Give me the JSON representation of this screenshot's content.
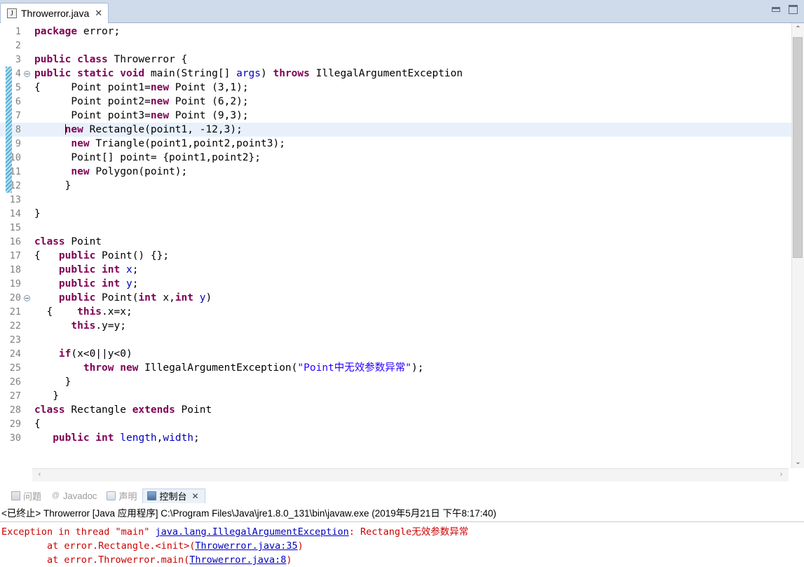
{
  "window": {
    "minimize_label": "Minimize",
    "maximize_label": "Maximize"
  },
  "editor": {
    "tab": {
      "title": "Throwerror.java",
      "icon": "java-file-icon",
      "icon_letter": "J",
      "close": "✕"
    },
    "scrollbar": {
      "up_arrow": "⌃",
      "down_arrow": "⌄",
      "left_arrow": "‹",
      "right_arrow": "›"
    },
    "lines": [
      {
        "n": "1",
        "fold": false,
        "annot": false,
        "hl": false,
        "html": "<span class='kw'>package</span> error;"
      },
      {
        "n": "2",
        "fold": false,
        "annot": false,
        "hl": false,
        "html": ""
      },
      {
        "n": "3",
        "fold": false,
        "annot": false,
        "hl": false,
        "html": "<span class='kw'>public class</span> Throwerror {"
      },
      {
        "n": "4",
        "fold": true,
        "annot": true,
        "hl": false,
        "html": "<span class='kw'>public static void</span> main(String[] <span class='fld'>args</span>) <span class='kw'>throws</span> IllegalArgumentException"
      },
      {
        "n": "5",
        "fold": false,
        "annot": true,
        "hl": false,
        "html": "{     Point point1=<span class='kw'>new</span> Point (3,1);"
      },
      {
        "n": "6",
        "fold": false,
        "annot": true,
        "hl": false,
        "html": "      Point point2=<span class='kw'>new</span> Point (6,2);"
      },
      {
        "n": "7",
        "fold": false,
        "annot": true,
        "hl": false,
        "html": "      Point point3=<span class='kw'>new</span> Point (9,3);"
      },
      {
        "n": "8",
        "fold": false,
        "annot": true,
        "hl": true,
        "html": "     <span class='caret'></span><span class='kw'>new</span> Rectangle(point1, -12,3);"
      },
      {
        "n": "9",
        "fold": false,
        "annot": true,
        "hl": false,
        "html": "      <span class='kw'>new</span> Triangle(point1,point2,point3);"
      },
      {
        "n": "10",
        "fold": false,
        "annot": true,
        "hl": false,
        "html": "      Point[] point= {point1,point2};"
      },
      {
        "n": "11",
        "fold": false,
        "annot": true,
        "hl": false,
        "html": "      <span class='kw'>new</span> Polygon(point);"
      },
      {
        "n": "12",
        "fold": false,
        "annot": true,
        "hl": false,
        "html": "     }"
      },
      {
        "n": "13",
        "fold": false,
        "annot": false,
        "hl": false,
        "html": ""
      },
      {
        "n": "14",
        "fold": false,
        "annot": false,
        "hl": false,
        "html": "}"
      },
      {
        "n": "15",
        "fold": false,
        "annot": false,
        "hl": false,
        "html": ""
      },
      {
        "n": "16",
        "fold": false,
        "annot": false,
        "hl": false,
        "html": "<span class='kw'>class</span> Point"
      },
      {
        "n": "17",
        "fold": false,
        "annot": false,
        "hl": false,
        "html": "{   <span class='kw'>public</span> Point() {};"
      },
      {
        "n": "18",
        "fold": false,
        "annot": false,
        "hl": false,
        "html": "    <span class='kw'>public int</span> <span class='fld'>x</span>;"
      },
      {
        "n": "19",
        "fold": false,
        "annot": false,
        "hl": false,
        "html": "    <span class='kw'>public int</span> <span class='fld'>y</span>;"
      },
      {
        "n": "20",
        "fold": true,
        "annot": false,
        "hl": false,
        "html": "    <span class='kw'>public</span> Point(<span class='kw'>int</span> x,<span class='kw'>int</span> <span class='fld'>y</span>)"
      },
      {
        "n": "21",
        "fold": false,
        "annot": false,
        "hl": false,
        "html": "  {    <span class='kw'>this</span>.x=x;"
      },
      {
        "n": "22",
        "fold": false,
        "annot": false,
        "hl": false,
        "html": "      <span class='kw'>this</span>.y=y;"
      },
      {
        "n": "23",
        "fold": false,
        "annot": false,
        "hl": false,
        "html": ""
      },
      {
        "n": "24",
        "fold": false,
        "annot": false,
        "hl": false,
        "html": "    <span class='kw'>if</span>(x&lt;0||y&lt;0)"
      },
      {
        "n": "25",
        "fold": false,
        "annot": false,
        "hl": false,
        "html": "        <span class='kw'>throw new</span> IllegalArgumentException(<span class='str'>\"Point中无效参数异常\"</span>);"
      },
      {
        "n": "26",
        "fold": false,
        "annot": false,
        "hl": false,
        "html": "     }"
      },
      {
        "n": "27",
        "fold": false,
        "annot": false,
        "hl": false,
        "html": "   }"
      },
      {
        "n": "28",
        "fold": false,
        "annot": false,
        "hl": false,
        "html": "<span class='kw'>class</span> Rectangle <span class='kw'>extends</span> Point"
      },
      {
        "n": "29",
        "fold": false,
        "annot": false,
        "hl": false,
        "html": "{"
      },
      {
        "n": "30",
        "fold": false,
        "annot": false,
        "hl": false,
        "html": "   <span class='kw'>public int</span> <span class='fld'>length</span>,<span class='fld'>width</span>;"
      }
    ]
  },
  "console": {
    "tabs": [
      {
        "label": "问题",
        "icon": "problems-icon",
        "active": false,
        "closable": false
      },
      {
        "label": "Javadoc",
        "icon": "javadoc-icon",
        "active": false,
        "closable": false
      },
      {
        "label": "声明",
        "icon": "declaration-icon",
        "active": false,
        "closable": false
      },
      {
        "label": "控制台",
        "icon": "console-icon",
        "active": true,
        "closable": true
      }
    ],
    "close_glyph": "✕",
    "header": "<已终止> Throwerror [Java 应用程序] C:\\Program Files\\Java\\jre1.8.0_131\\bin\\javaw.exe  (2019年5月21日 下午8:17:40)",
    "output": [
      {
        "parts": [
          {
            "t": "Exception in thread \"main\" ",
            "link": false
          },
          {
            "t": "java.lang.IllegalArgumentException",
            "link": true
          },
          {
            "t": ": Rectangle无效参数异常",
            "link": false
          }
        ]
      },
      {
        "parts": [
          {
            "t": "        at error.Rectangle.<init>(",
            "link": false
          },
          {
            "t": "Throwerror.java:35",
            "link": true
          },
          {
            "t": ")",
            "link": false
          }
        ]
      },
      {
        "parts": [
          {
            "t": "        at error.Throwerror.main(",
            "link": false
          },
          {
            "t": "Throwerror.java:8",
            "link": true
          },
          {
            "t": ")",
            "link": false
          }
        ]
      }
    ]
  },
  "colors": {
    "keyword": "#7f0055",
    "string": "#2a00ff",
    "field": "#0000c0",
    "error": "#cc0000",
    "link": "#0000c0",
    "tabbar_bg": "#cfdaea",
    "line_highlight": "#e8f0fb"
  }
}
